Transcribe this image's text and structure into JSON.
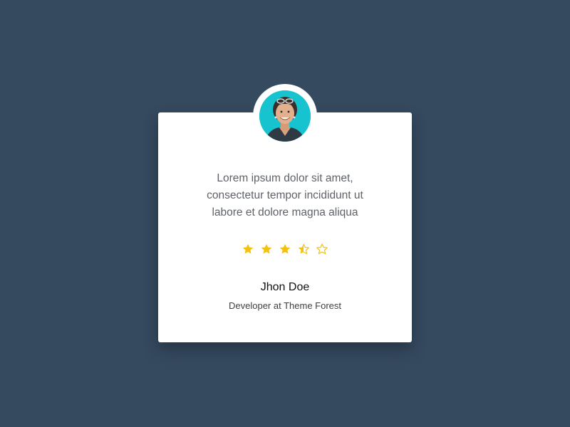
{
  "colors": {
    "background": "#35495f",
    "card": "#ffffff",
    "star": "#f4c20d",
    "avatar_background": "#17c3cf"
  },
  "testimonial": {
    "quote_lines": [
      "Lorem ipsum dolor sit amet,",
      "consectetur tempor incididunt ut",
      "labore et dolore magna aliqua"
    ],
    "rating": 3.5,
    "rating_max": 5,
    "name": "Jhon Doe",
    "role": "Developer at Theme Forest"
  },
  "icons": {
    "avatar": "person-photo",
    "stars": [
      "star-filled-icon",
      "star-filled-icon",
      "star-filled-icon",
      "star-half-icon",
      "star-outline-icon"
    ]
  }
}
